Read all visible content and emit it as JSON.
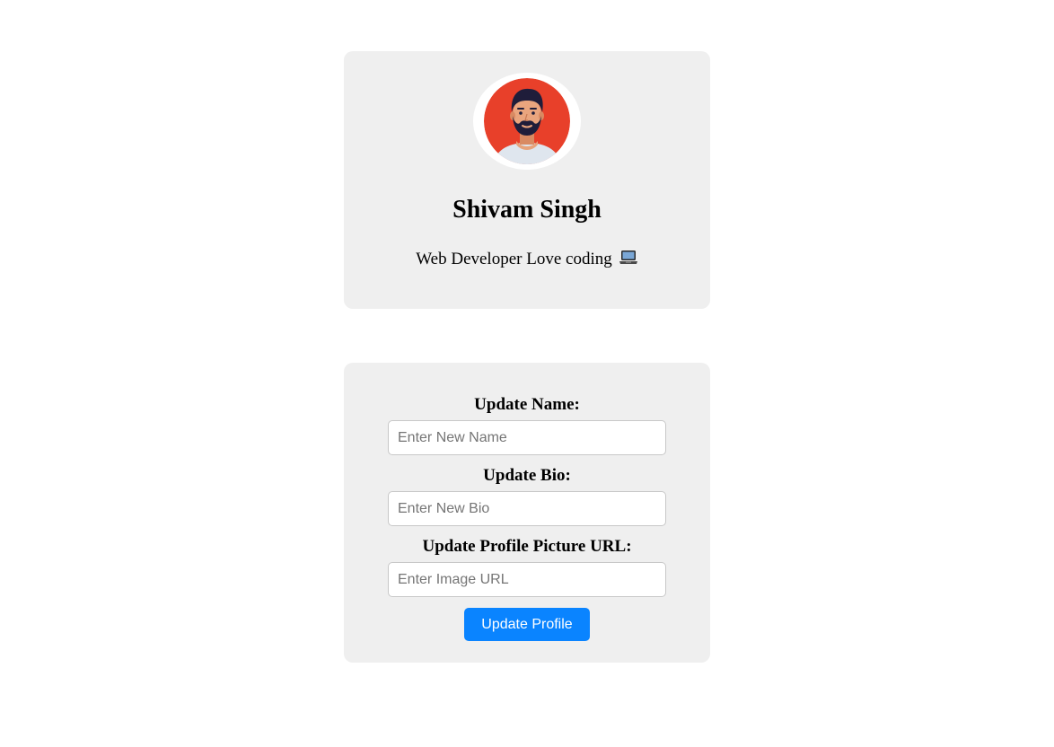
{
  "profile": {
    "name": "Shivam Singh",
    "bio": "Web Developer Love coding",
    "bio_icon": "laptop-icon",
    "avatar_icon": "bearded-man-avatar",
    "avatar_background": "#e8402a"
  },
  "form": {
    "name_label": "Update Name:",
    "name_placeholder": "Enter New Name",
    "bio_label": "Update Bio:",
    "bio_placeholder": "Enter New Bio",
    "picture_label": "Update Profile Picture URL:",
    "picture_placeholder": "Enter Image URL",
    "submit_label": "Update Profile",
    "accent_color": "#0a84ff"
  }
}
